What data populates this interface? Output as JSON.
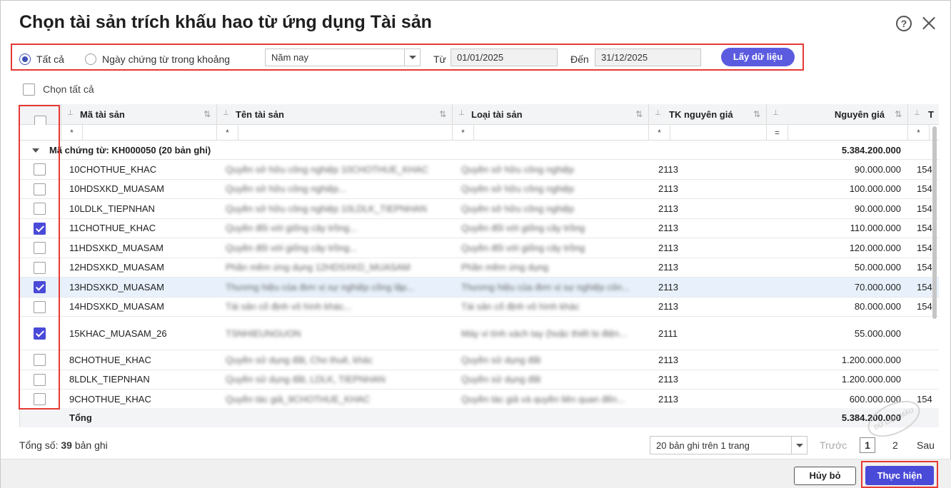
{
  "dialog": {
    "title": "Chọn tài sản trích khấu hao từ ứng dụng Tài sản"
  },
  "filter": {
    "all_label": "Tất cả",
    "range_label": "Ngày chứng từ trong khoảng",
    "period_value": "Năm nay",
    "from_label": "Từ",
    "from_value": "01/01/2025",
    "to_label": "Đến",
    "to_value": "31/12/2025",
    "fetch_button": "Lấy dữ liệu",
    "selected_option": "all"
  },
  "select_all_label": "Chọn tất cả",
  "grid": {
    "columns": [
      {
        "label": "Mã tài sản",
        "filter_op": "*"
      },
      {
        "label": "Tên tài sản",
        "filter_op": "*"
      },
      {
        "label": "Loại tài sản",
        "filter_op": "*"
      },
      {
        "label": "TK nguyên giá",
        "filter_op": "*"
      },
      {
        "label": "Nguyên giá",
        "filter_op": "="
      },
      {
        "label": "T",
        "filter_op": "*"
      }
    ],
    "group": {
      "label": "Mã chứng từ: KH000050 (20 bản ghi)",
      "total": "5.384.200.000"
    },
    "rows": [
      {
        "code": "10CHOTHUE_KHAC",
        "name": "Quyền sở hữu công nghiệp 10CHOTHUE_KHAC",
        "type": "Quyền sở hữu công nghiệp",
        "account": "2113",
        "cost": "90.000.000",
        "extra": "154",
        "checked": false
      },
      {
        "code": "10HDSXKD_MUASAM",
        "name": "Quyền sở hữu công nghiệp...",
        "type": "Quyền sở hữu công nghiệp",
        "account": "2113",
        "cost": "100.000.000",
        "extra": "154",
        "checked": false
      },
      {
        "code": "10LDLK_TIEPNHAN",
        "name": "Quyền sở hữu công nghiệp 10LDLK_TIEPNHAN",
        "type": "Quyền sở hữu công nghiệp",
        "account": "2113",
        "cost": "90.000.000",
        "extra": "154",
        "checked": false
      },
      {
        "code": "11CHOTHUE_KHAC",
        "name": "Quyền đối với giống cây trồng...",
        "type": "Quyền đối với giống cây trồng",
        "account": "2113",
        "cost": "110.000.000",
        "extra": "154",
        "checked": true
      },
      {
        "code": "11HDSXKD_MUASAM",
        "name": "Quyền đối với giống cây trồng...",
        "type": "Quyền đối với giống cây trồng",
        "account": "2113",
        "cost": "120.000.000",
        "extra": "154",
        "checked": false
      },
      {
        "code": "12HDSXKD_MUASAM",
        "name": "Phần mềm ứng dụng 12HDSXKD_MUASAM",
        "type": "Phần mềm ứng dụng",
        "account": "2113",
        "cost": "50.000.000",
        "extra": "154",
        "checked": false
      },
      {
        "code": "13HDSXKD_MUASAM",
        "name": "Thương hiệu của đơn vị sự nghiệp công lập...",
        "type": "Thương hiệu của đơn vị sự nghiệp côn...",
        "account": "2113",
        "cost": "70.000.000",
        "extra": "154",
        "checked": true,
        "highlight": true
      },
      {
        "code": "14HDSXKD_MUASAM",
        "name": "Tài sản cố định vô hình khác...",
        "type": "Tài sản cố định vô hình khác",
        "account": "2113",
        "cost": "80.000.000",
        "extra": "154",
        "checked": false
      },
      {
        "code": "15KHAC_MUASAM_26",
        "name": "TSNHIEUNGUON",
        "type": "Máy vi tính xách tay (hoặc thiết bị điện...",
        "account": "2111",
        "cost": "55.000.000",
        "extra": "",
        "checked": true,
        "tall": true
      },
      {
        "code": "8CHOTHUE_KHAC",
        "name": "Quyền sử dụng đất, Cho thuê, khác",
        "type": "Quyền sử dụng đất",
        "account": "2113",
        "cost": "1.200.000.000",
        "extra": "",
        "checked": false
      },
      {
        "code": "8LDLK_TIEPNHAN",
        "name": "Quyền sử dụng đất, LDLK, TIEPNHAN",
        "type": "Quyền sử dụng đất",
        "account": "2113",
        "cost": "1.200.000.000",
        "extra": "",
        "checked": false
      },
      {
        "code": "9CHOTHUE_KHAC",
        "name": "Quyền tác giả_9CHOTHUE_KHAC",
        "type": "Quyền tác giả và quyền liên quan đến...",
        "account": "2113",
        "cost": "600.000.000",
        "extra": "154",
        "checked": false
      }
    ],
    "total_label": "Tổng",
    "total_value": "5.384.200.000"
  },
  "footer": {
    "total_prefix": "Tổng số:",
    "total_count": "39",
    "total_suffix": "bản ghi",
    "page_size": "20 bản ghi trên 1 trang",
    "prev": "Trước",
    "page1": "1",
    "page2": "2",
    "next": "Sau"
  },
  "actions": {
    "cancel": "Hủy bỏ",
    "execute": "Thực hiện"
  },
  "watermark": "DỮ LIỆU MẪU",
  "colors": {
    "primary": "#4a4ad8",
    "highlight_border": "#e53935",
    "selected_row": "#e8f1fb"
  }
}
